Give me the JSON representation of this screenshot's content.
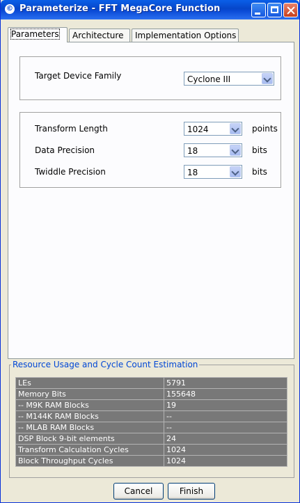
{
  "window": {
    "title": "Parameterize - FFT MegaCore Function",
    "icon_glyph": "©"
  },
  "tabs": [
    {
      "label": "Parameters",
      "active": true
    },
    {
      "label": "Architecture",
      "active": false
    },
    {
      "label": "Implementation Options",
      "active": false
    }
  ],
  "device": {
    "label": "Target Device Family",
    "value": "Cyclone III"
  },
  "transform": {
    "label": "Transform Length",
    "value": "1024",
    "unit": "points"
  },
  "data_precision": {
    "label": "Data Precision",
    "value": "18",
    "unit": "bits"
  },
  "twiddle_precision": {
    "label": "Twiddle Precision",
    "value": "18",
    "unit": "bits"
  },
  "resource": {
    "title": "Resource Usage and Cycle Count Estimation",
    "rows": [
      {
        "name": "LEs",
        "value": "5791"
      },
      {
        "name": "Memory Bits",
        "value": "155648"
      },
      {
        "name": "-- M9K RAM Blocks",
        "value": "19"
      },
      {
        "name": "-- M144K RAM Blocks",
        "value": "--"
      },
      {
        "name": "-- MLAB RAM Blocks",
        "value": "--"
      },
      {
        "name": "DSP Block 9-bit elements",
        "value": "24"
      },
      {
        "name": "Transform Calculation Cycles",
        "value": "1024"
      },
      {
        "name": "Block Throughput Cycles",
        "value": "1024"
      }
    ]
  },
  "buttons": {
    "cancel": "Cancel",
    "finish": "Finish"
  },
  "colors": {
    "title_bar": "#0a4ad6",
    "resource_title": "#0046d5",
    "table_bg": "#787878"
  }
}
